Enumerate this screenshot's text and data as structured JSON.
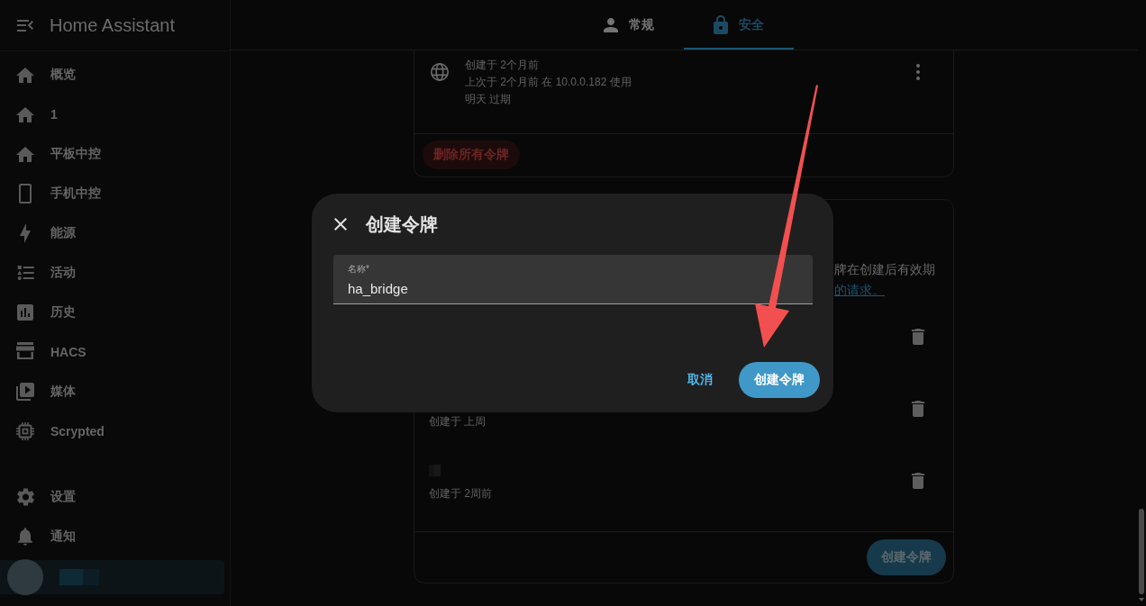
{
  "sidebar": {
    "title": "Home Assistant",
    "items": [
      {
        "label": "概览",
        "selected": false
      },
      {
        "label": "1",
        "selected": false
      },
      {
        "label": "平板中控",
        "selected": false
      },
      {
        "label": "手机中控",
        "selected": false
      },
      {
        "label": "能源",
        "selected": false
      },
      {
        "label": "活动",
        "selected": false
      },
      {
        "label": "历史",
        "selected": false
      },
      {
        "label": "HACS",
        "selected": false
      },
      {
        "label": "媒体",
        "selected": false
      },
      {
        "label": "Scrypted",
        "selected": false
      }
    ],
    "bottom_items": [
      {
        "label": "设置",
        "selected": false
      },
      {
        "label": "通知",
        "selected": false
      }
    ],
    "user": {
      "selected": true
    }
  },
  "tabs": [
    {
      "label": "常规",
      "selected": false
    },
    {
      "label": "安全",
      "selected": true
    }
  ],
  "refresh_tokens": {
    "token": {
      "details": [
        "创建于 2个月前",
        "上次于 2个月前 在 10.0.0.182 使用",
        "明天 过期"
      ]
    },
    "delete_all_button": "删除所有令牌"
  },
  "long_lived_tokens": {
    "description": {
      "text": "牌在创建后有效期",
      "link": "的请求。"
    },
    "tokens": [
      {
        "name_redacted": false
      },
      {
        "name_redacted": false,
        "created": "创建于 上周"
      },
      {
        "name_redacted": true,
        "created": "创建于 2周前"
      }
    ],
    "create_button": "创建令牌"
  },
  "dialog": {
    "title": "创建令牌",
    "field": {
      "label": "名称*",
      "value": "ha_bridge"
    },
    "buttons": [
      {
        "label": "取消",
        "kind": "text"
      },
      {
        "label": "创建令牌",
        "kind": "filled"
      }
    ]
  }
}
